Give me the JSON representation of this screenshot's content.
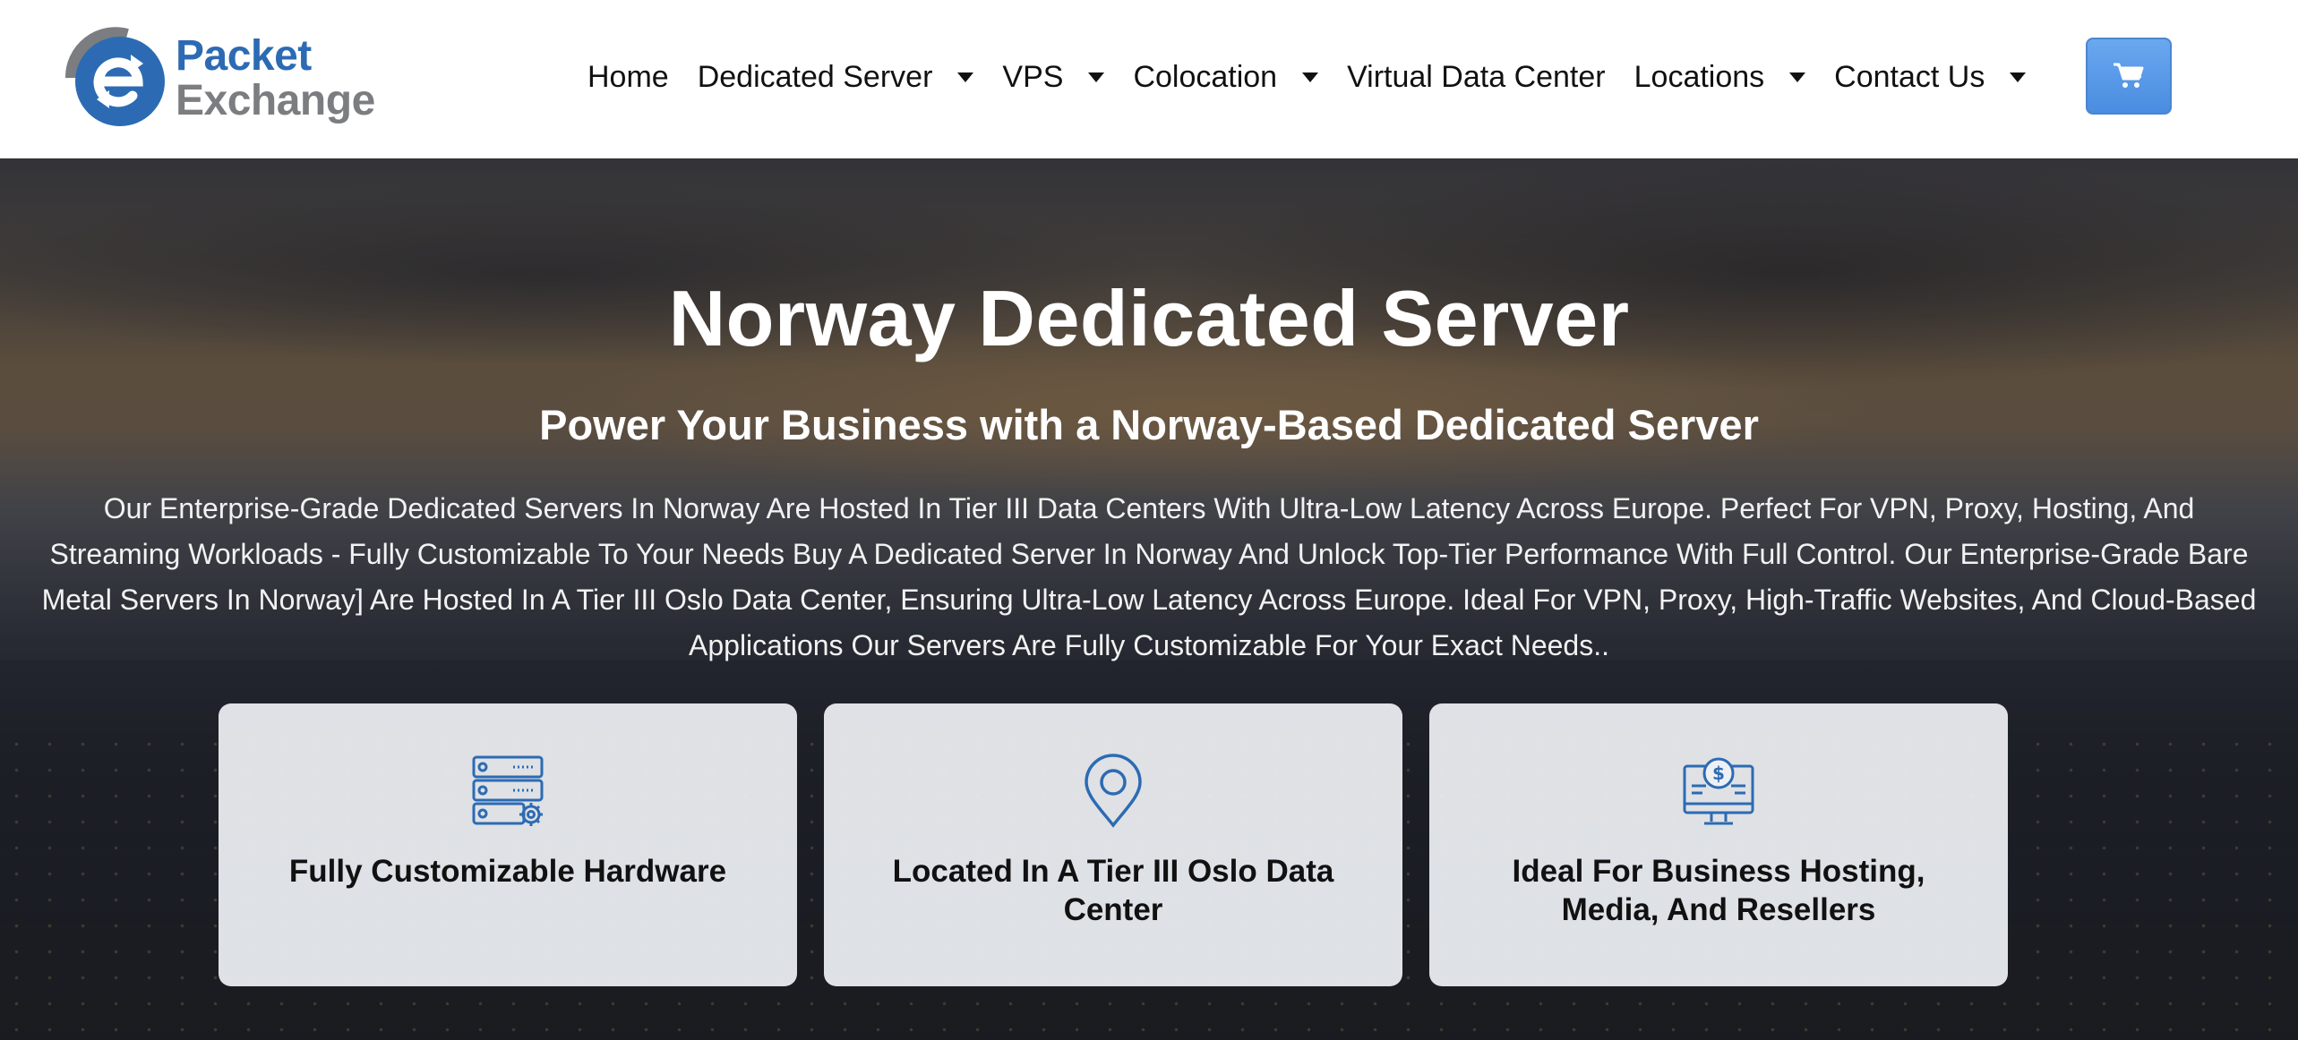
{
  "brand": {
    "line1": "Packet",
    "line2": "Exchange",
    "logo_icon": "packet-exchange-logo",
    "colors": {
      "blue": "#2c6bb3",
      "gray": "#7b7d80"
    }
  },
  "nav": {
    "items": [
      {
        "label": "Home",
        "has_dropdown": false
      },
      {
        "label": "Dedicated Server",
        "has_dropdown": true
      },
      {
        "label": "VPS",
        "has_dropdown": true
      },
      {
        "label": "Colocation",
        "has_dropdown": true
      },
      {
        "label": "Virtual Data Center",
        "has_dropdown": false
      },
      {
        "label": "Locations",
        "has_dropdown": true
      },
      {
        "label": "Contact Us",
        "has_dropdown": true
      }
    ],
    "cart_icon": "shopping-cart-icon",
    "cart_color": "#4a8ce0"
  },
  "hero": {
    "title": "Norway Dedicated Server",
    "subtitle": "Power Your Business with a Norway-Based Dedicated Server",
    "description": "Our Enterprise-Grade Dedicated Servers In Norway Are Hosted In Tier III Data Centers With Ultra-Low Latency Across Europe. Perfect For VPN, Proxy, Hosting, And Streaming Workloads - Fully Customizable To Your Needs Buy A Dedicated Server In Norway And Unlock Top-Tier Performance With Full Control. Our Enterprise-Grade Bare Metal Servers In Norway] Are Hosted In A Tier III Oslo Data Center, Ensuring Ultra-Low Latency Across Europe. Ideal For VPN, Proxy, High-Traffic Websites, And Cloud-Based Applications Our Servers Are Fully Customizable For Your Exact Needs.."
  },
  "features": [
    {
      "icon": "server-settings-icon",
      "title": "Fully Customizable Hardware"
    },
    {
      "icon": "location-pin-icon",
      "title": "Located In A Tier III Oslo Data Center"
    },
    {
      "icon": "monitor-dollar-icon",
      "title": "Ideal For Business Hosting, Media, And Resellers"
    }
  ],
  "accent_color": "#2c6bb3"
}
